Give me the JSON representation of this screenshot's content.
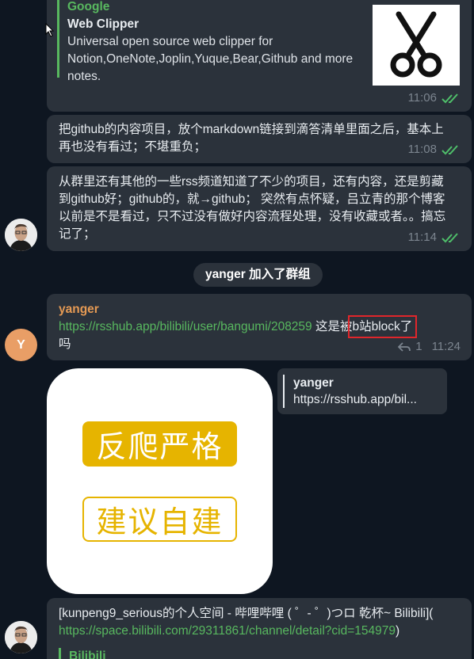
{
  "msg1": {
    "preview_site": "Google",
    "preview_title": "Web Clipper",
    "preview_desc": "Universal open source web clipper for Notion,OneNote,Joplin,Yuque,Bear,Github and more notes.",
    "time": "11:06",
    "thumbnail_icon": "scissors-icon"
  },
  "msg2": {
    "text": "把github的内容项目，放个markdown链接到滴答清单里面之后，基本上再也没有看过；不堪重负；",
    "time": "11:08"
  },
  "msg3": {
    "text": "从群里还有其他的一些rss频道知道了不少的项目，还有内容，还是剪藏到github好；github的，就→github；   突然有点怀疑，吕立青的那个博客以前是不是看过，只不过没有做好内容流程处理，没有收藏或者。。搞忘记了；",
    "time": "11:14"
  },
  "service": {
    "text": "yanger 加入了群组"
  },
  "msg4": {
    "author": "yanger",
    "avatar_letter": "Y",
    "link": "https://rsshub.app/bilibili/user/bangumi/208259",
    "text_before": " 这是被",
    "highlight": "b站block了",
    "text_after": "吗",
    "replies": "1",
    "time": "11:24",
    "highlight_color": "#e0262b"
  },
  "sticker": {
    "line1": "反爬严格",
    "line2": "建议自建",
    "accent": "#e6b400"
  },
  "reply_preview": {
    "author": "yanger",
    "text": "https://rsshub.app/bil..."
  },
  "msg5": {
    "text": "[kunpeng9_serious的个人空间 - 哔哩哔哩 ( ゜- ゜)つロ 乾杯~ Bilibili](",
    "link": "https://space.bilibili.com/29311861/channel/detail?cid=154979",
    "link_suffix": ")",
    "preview_site": "Bilibili"
  },
  "colors": {
    "background": "#0e1621",
    "bubble": "#2b323b",
    "link": "#58b85f",
    "check": "#4fbf6a"
  }
}
